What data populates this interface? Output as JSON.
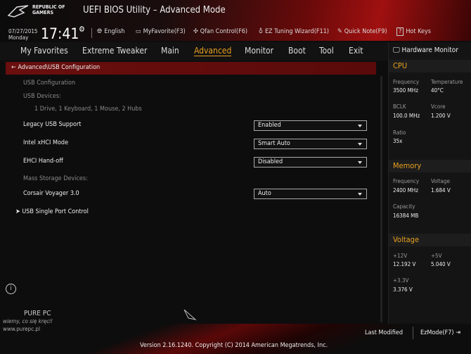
{
  "header": {
    "brand": "REPUBLIC OF GAMERS",
    "title": "UEFI BIOS Utility – Advanced Mode",
    "date": "07/27/2015",
    "day": "Monday",
    "time": "17:41"
  },
  "toolbar": [
    {
      "icon": "globe-icon",
      "label": "English"
    },
    {
      "icon": "favorite-icon",
      "label": "MyFavorite(F3)"
    },
    {
      "icon": "fan-icon",
      "label": "Qfan Control(F6)"
    },
    {
      "icon": "bulb-icon",
      "label": "EZ Tuning Wizard(F11)"
    },
    {
      "icon": "note-icon",
      "label": "Quick Note(F9)"
    },
    {
      "icon": "help-icon",
      "label": "Hot Keys"
    }
  ],
  "nav": [
    "My Favorites",
    "Extreme Tweaker",
    "Main",
    "Advanced",
    "Monitor",
    "Boot",
    "Tool",
    "Exit"
  ],
  "active_tab": "Advanced",
  "breadcrumb": "Advanced\\USB Configuration",
  "main": {
    "usb_config": "USB Configuration",
    "usb_devices": "USB Devices:",
    "devices": "1 Drive, 1 Keyboard, 1 Mouse, 2 Hubs",
    "legacy": {
      "label": "Legacy USB Support",
      "value": "Enabled"
    },
    "xhci": {
      "label": "Intel xHCI Mode",
      "value": "Smart Auto"
    },
    "ehci": {
      "label": "EHCI Hand-off",
      "value": "Disabled"
    },
    "mass": "Mass Storage Devices:",
    "corsair": {
      "label": "Corsair Voyager 3.0",
      "value": "Auto"
    },
    "single": "USB Single Port Control"
  },
  "hw": {
    "title": "Hardware Monitor",
    "cpu": "CPU",
    "freq_l": "Frequency",
    "freq": "3500 MHz",
    "temp_l": "Temperature",
    "temp": "40°C",
    "bclk_l": "BCLK",
    "bclk": "100.0 MHz",
    "vcore_l": "Vcore",
    "vcore": "1.200 V",
    "ratio_l": "Ratio",
    "ratio": "35x",
    "memory": "Memory",
    "mfreq_l": "Frequency",
    "mfreq": "2400 MHz",
    "volt_l": "Voltage",
    "volt": "1.684 V",
    "cap_l": "Capacity",
    "cap": "16384 MB",
    "voltage": "Voltage",
    "v12_l": "+12V",
    "v12": "12.192 V",
    "v5_l": "+5V",
    "v5": "5.040 V",
    "v33_l": "+3.3V",
    "v33": "3.376 V"
  },
  "footer": {
    "last_modified": "Last Modified",
    "ezmode": "EzMode(F7)",
    "version": "Version 2.16.1240. Copyright (C) 2014 American Megatrends, Inc."
  },
  "watermark": {
    "brand": "PURE PC",
    "slogan": "wiemy, co się kręci!",
    "url": "www.purepc.pl"
  },
  "colors": {
    "accent": "#e8a020",
    "header_red": "#a01010"
  }
}
